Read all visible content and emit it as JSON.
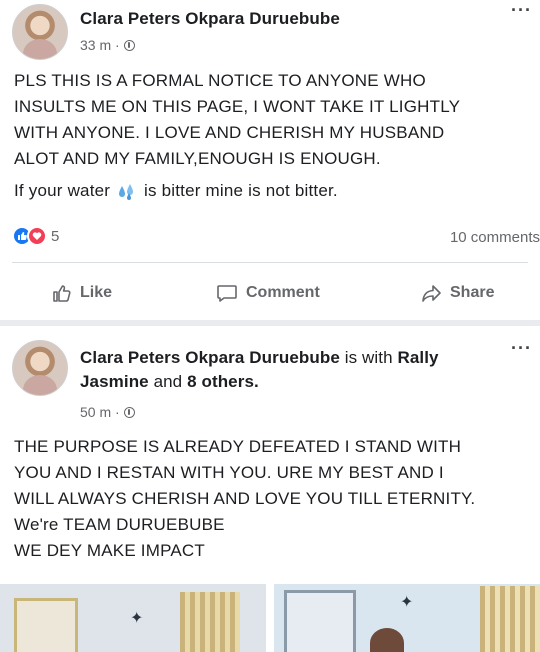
{
  "post1": {
    "author": "Clara Peters Okpara Duruebube",
    "time": "33 m ·",
    "more_icon": "ellipsis-icon",
    "lines": [
      "PLS THIS IS A FORMAL NOTICE TO ANYONE WHO",
      "INSULTS ME ON THIS PAGE, I WONT TAKE IT LIGHTLY",
      "WITH ANYONE. I LOVE AND CHERISH MY HUSBAND",
      "ALOT AND MY FAMILY,ENOUGH IS ENOUGH."
    ],
    "water_before": "If your water",
    "water_after": "is bitter mine is not bitter.",
    "reaction_count": "5",
    "comments": "10 comments",
    "actions": {
      "like": "Like",
      "comment": "Comment",
      "share": "Share"
    }
  },
  "post2": {
    "author": "Clara Peters Okpara Duruebube",
    "with_text": "is with",
    "tagged": "Rally",
    "tagged_line2": "Jasmine",
    "and_text": "and",
    "others": "8 others.",
    "time": "50 m ·",
    "lines": [
      "THE PURPOSE IS ALREADY DEFEATED I STAND WITH",
      "YOU AND I RESTAN WITH YOU. URE MY BEST AND I",
      "WILL ALWAYS CHERISH AND LOVE YOU TILL ETERNITY.",
      "We're TEAM DURUEBUBE",
      "WE DEY MAKE IMPACT"
    ]
  },
  "colors": {
    "like_blue": "#1877f2",
    "love_red": "#f33e58",
    "meta_gray": "#65676b",
    "text": "#1c1e21"
  }
}
